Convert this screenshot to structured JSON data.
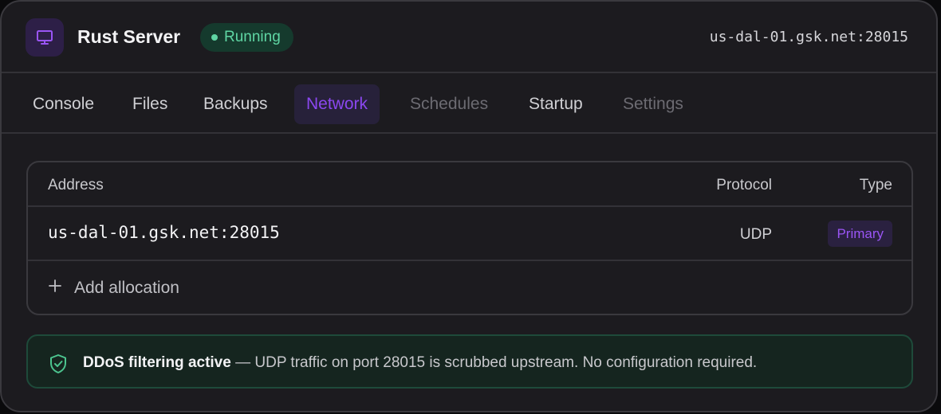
{
  "header": {
    "icon": "monitor-icon",
    "server_name": "Rust Server",
    "status": "Running",
    "status_color": "#5fd6a4",
    "address": "us-dal-01.gsk.net:28015"
  },
  "tabs": [
    {
      "label": "Console",
      "state": "normal"
    },
    {
      "label": "Files",
      "state": "normal"
    },
    {
      "label": "Backups",
      "state": "normal"
    },
    {
      "label": "Network",
      "state": "active"
    },
    {
      "label": "Schedules",
      "state": "disabled"
    },
    {
      "label": "Startup",
      "state": "normal"
    },
    {
      "label": "Settings",
      "state": "disabled"
    }
  ],
  "accent_color": "#8b47f0",
  "allocations": {
    "columns": {
      "address": "Address",
      "protocol": "Protocol",
      "type": "Type"
    },
    "rows": [
      {
        "address": "us-dal-01.gsk.net:28015",
        "protocol": "UDP",
        "type": "Primary"
      }
    ],
    "add_label": "Add allocation"
  },
  "ddos_notice": {
    "icon": "shield-check-icon",
    "title": "DDoS filtering active",
    "message": " — UDP traffic on port 28015 is scrubbed upstream. No configuration required."
  }
}
